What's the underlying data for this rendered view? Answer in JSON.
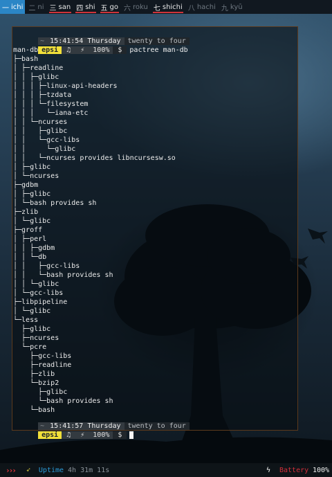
{
  "workspaces": [
    {
      "num": "一",
      "name": "ichi",
      "state": "active"
    },
    {
      "num": "二",
      "name": "ni",
      "state": "empty"
    },
    {
      "num": "三",
      "name": "san",
      "state": "occupied"
    },
    {
      "num": "四",
      "name": "shi",
      "state": "occupied"
    },
    {
      "num": "五",
      "name": "go",
      "state": "occupied"
    },
    {
      "num": "六",
      "name": "roku",
      "state": "empty"
    },
    {
      "num": "七",
      "name": "shichi",
      "state": "occupied"
    },
    {
      "num": "八",
      "name": "hachi",
      "state": "empty"
    },
    {
      "num": "九",
      "name": "kyū",
      "state": "empty"
    }
  ],
  "prompt_top": {
    "corner": "~",
    "time": "15:41:54 Thursday",
    "human_time": "twenty to four",
    "user": "epsi",
    "note_icon": "♫",
    "bolt_icon": "⚡",
    "battery": "100%",
    "dollar": "$",
    "command": "pactree man-db"
  },
  "tree_lines": [
    "man-db",
    "├─bash",
    "│ ├─readline",
    "│ │ ├─glibc",
    "│ │ │ ├─linux-api-headers",
    "│ │ │ ├─tzdata",
    "│ │ │ └─filesystem",
    "│ │ │   └─iana-etc",
    "│ │ └─ncurses",
    "│ │   ├─glibc",
    "│ │   └─gcc-libs",
    "│ │     └─glibc",
    "│ │   └─ncurses provides libncursesw.so",
    "│ ├─glibc",
    "│ └─ncurses",
    "├─gdbm",
    "│ ├─glibc",
    "│ └─bash provides sh",
    "├─zlib",
    "│ └─glibc",
    "├─groff",
    "│ ├─perl",
    "│ │ ├─gdbm",
    "│ │ └─db",
    "│ │   ├─gcc-libs",
    "│ │   └─bash provides sh",
    "│ │ └─glibc",
    "│ └─gcc-libs",
    "├─libpipeline",
    "│ └─glibc",
    "└─less",
    "  ├─glibc",
    "  ├─ncurses",
    "  └─pcre",
    "    ├─gcc-libs",
    "    ├─readline",
    "    ├─zlib",
    "    └─bzip2",
    "      ├─glibc",
    "      └─bash provides sh",
    "    └─bash"
  ],
  "prompt_bottom": {
    "corner": "~",
    "time": "15:41:57 Thursday",
    "human_time": "twenty to four",
    "user": "epsi",
    "note_icon": "♫",
    "bolt_icon": "⚡",
    "battery": "100%",
    "dollar": "$"
  },
  "statusbar": {
    "menu_icon": "›››",
    "lightning_icon": "➶",
    "uptime_label": "Uptime",
    "uptime_value": "4h 31m 11s",
    "battery_icon": "ϟ",
    "battery_label": "Battery",
    "battery_value": "100%"
  },
  "colors": {
    "active_workspace": "#2b86c6",
    "occupied_underline": "#d0343a",
    "prompt_user_bg": "#f2e03a",
    "uptime_label": "#2b9bd8",
    "battery_label": "#d02f3a"
  }
}
